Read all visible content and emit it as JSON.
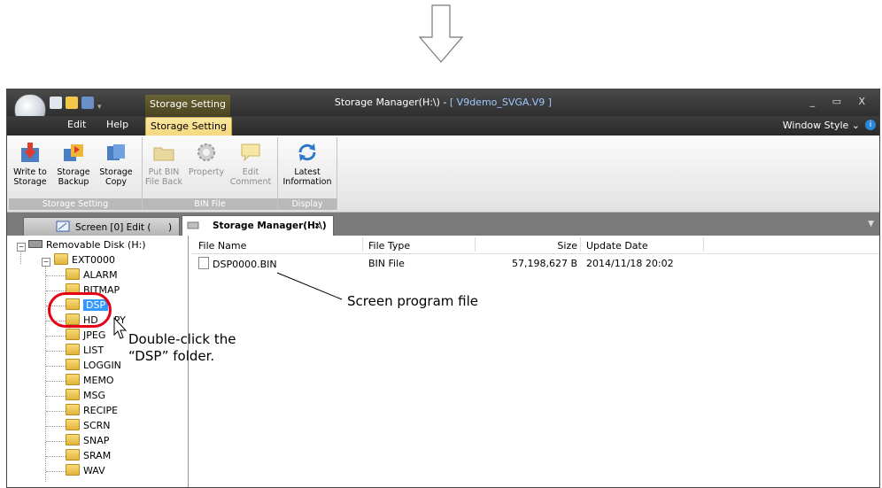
{
  "window": {
    "title": "Storage Manager(H:\\) - ",
    "document": "[ V9demo_SVGA.V9 ]",
    "context_tab_label": "Storage Setting",
    "window_style": "Window Style",
    "controls": "_ ▭ X"
  },
  "menu": {
    "edit": "Edit",
    "help": "Help",
    "storage_setting_tab": "Storage Setting"
  },
  "ribbon": {
    "groups": [
      {
        "label": "Storage Setting",
        "buttons": [
          {
            "line1": "Write to",
            "line2": "Storage",
            "icon": "write-storage-icon"
          },
          {
            "line1": "Storage",
            "line2": "Backup",
            "icon": "storage-backup-icon"
          },
          {
            "line1": "Storage",
            "line2": "Copy",
            "icon": "storage-copy-icon"
          }
        ]
      },
      {
        "label": "BIN File",
        "buttons": [
          {
            "line1": "Put BIN",
            "line2": "File Back",
            "icon": "folder-icon"
          },
          {
            "line1": "Property",
            "line2": "",
            "icon": "gear-icon"
          },
          {
            "line1": "Edit",
            "line2": "Comment",
            "icon": "comment-icon"
          }
        ]
      },
      {
        "label": "Display",
        "buttons": [
          {
            "line1": "Latest",
            "line2": "Information",
            "icon": "refresh-icon"
          }
        ]
      }
    ]
  },
  "tabs": {
    "screen": "Screen [0] Edit (",
    "screen_close": ")",
    "storage": "Storage Manager(H:\\)",
    "close": "×"
  },
  "tree": {
    "root": "Removable Disk (H:)",
    "folder": "EXT0000",
    "children": [
      "ALARM",
      "BITMAP",
      "DSP",
      "HDCOPY",
      "JPEG",
      "LIST",
      "LOGGING",
      "MEMO",
      "MSG",
      "RECIPE",
      "SCRN",
      "SNAP",
      "SRAM",
      "WAV"
    ],
    "visible_children": [
      "ALARM",
      "BITMAP",
      "DSP",
      "HD",
      "PY",
      "JPEG",
      "LIST",
      "LOGGIN",
      "MEMO",
      "MSG",
      "RECIPE",
      "SCRN",
      "SNAP",
      "SRAM",
      "WAV"
    ]
  },
  "list": {
    "headers": [
      "File Name",
      "File Type",
      "Size",
      "Update Date"
    ],
    "rows": [
      {
        "name": "DSP0000.BIN",
        "type": "BIN File",
        "size": "57,198,627 B",
        "date": "2014/11/18 20:02"
      }
    ]
  },
  "annotations": {
    "screen_program": "Screen program file",
    "double_click_line1": "Double-click the",
    "double_click_line2": "“DSP” folder."
  },
  "colors": {
    "selection": "#3399ff",
    "highlight_oval": "#e60012",
    "context_tab": "#f5d77a"
  }
}
